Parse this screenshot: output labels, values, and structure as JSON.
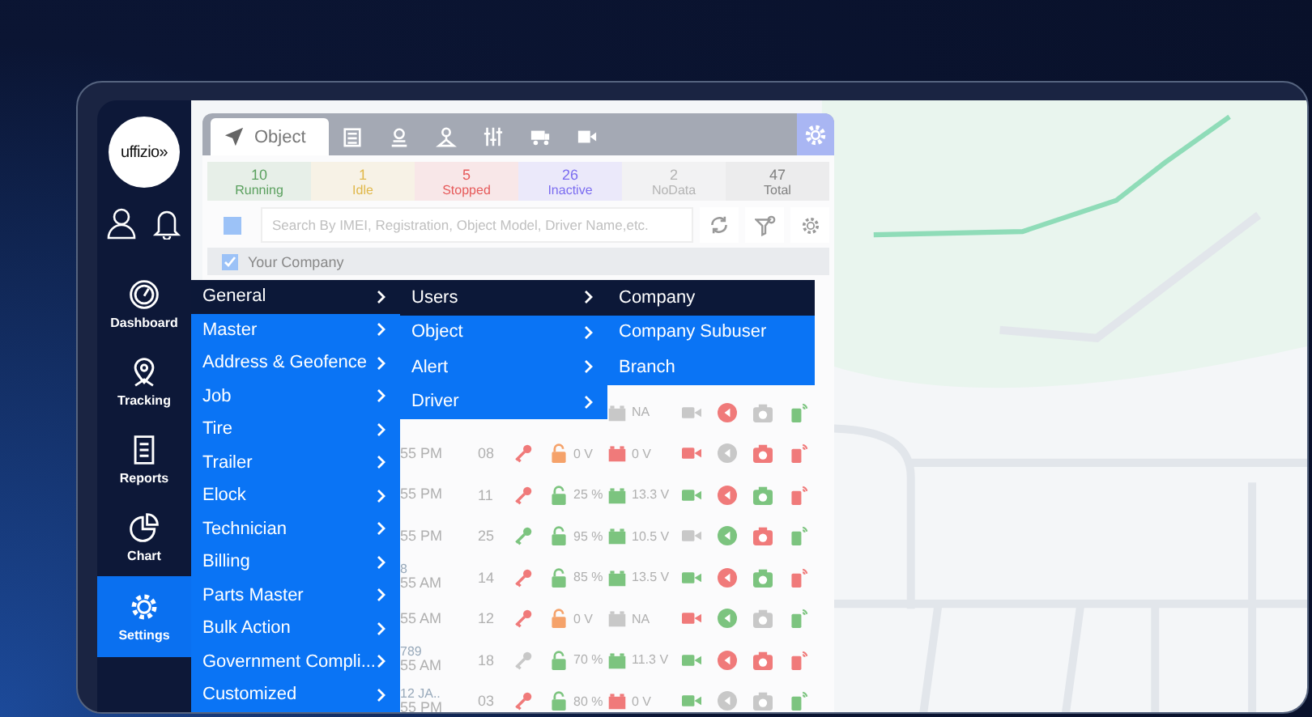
{
  "sidebar": {
    "logo": "uffizio»",
    "items": [
      {
        "label": "Dashboard",
        "selected": false
      },
      {
        "label": "Tracking",
        "selected": false
      },
      {
        "label": "Reports",
        "selected": false
      },
      {
        "label": "Chart",
        "selected": false
      },
      {
        "label": "Settings",
        "selected": true
      }
    ]
  },
  "panel": {
    "tabs": [
      {
        "label": "Object",
        "selected": true
      },
      {
        "selected": false
      },
      {
        "selected": false
      },
      {
        "selected": false
      },
      {
        "selected": false
      },
      {
        "selected": false
      },
      {
        "selected": false
      }
    ],
    "status": [
      {
        "count": "10",
        "label": "Running",
        "color": "#5aa05e"
      },
      {
        "count": "1",
        "label": "Idle",
        "color": "#e0b84a"
      },
      {
        "count": "5",
        "label": "Stopped",
        "color": "#e65a5a"
      },
      {
        "count": "26",
        "label": "Inactive",
        "color": "#7b6cf0"
      },
      {
        "count": "2",
        "label": "NoData",
        "color": "#b4b4b4"
      },
      {
        "count": "47",
        "label": "Total",
        "color": "#808080"
      }
    ],
    "search": {
      "placeholder": "Search By IMEI, Registration, Object Model, Driver Name,etc."
    },
    "company": {
      "label": "Your Company",
      "checked": true
    },
    "rows": [
      {
        "battery": {
          "color": "#c8c8c8",
          "reading": "NA"
        },
        "video": {
          "color": "#c8c8c8"
        },
        "rewind": {
          "color": "#f07a7a"
        },
        "camera": {
          "color": "#c8c8c8"
        },
        "phone": {
          "color": "#7cc47f"
        }
      },
      {
        "time": "55 PM",
        "number": "08",
        "key": {
          "color": "#f07a7a"
        },
        "lock": {
          "color": "#f5a26a",
          "reading": "0 V"
        },
        "battery": {
          "color": "#f07a7a",
          "reading": "0 V"
        },
        "video": {
          "color": "#f07a7a"
        },
        "rewind": {
          "color": "#c8c8c8"
        },
        "camera": {
          "color": "#f07a7a"
        },
        "phone": {
          "color": "#f07a7a"
        }
      },
      {
        "time": "55 PM",
        "number": "11",
        "key": {
          "color": "#f07a7a"
        },
        "lock": {
          "color": "#7cc47f",
          "reading": "25 %"
        },
        "battery": {
          "color": "#7cc47f",
          "reading": "13.3 V"
        },
        "video": {
          "color": "#7cc47f"
        },
        "rewind": {
          "color": "#f07a7a"
        },
        "camera": {
          "color": "#7cc47f"
        },
        "phone": {
          "color": "#f07a7a"
        }
      },
      {
        "time": "55 PM",
        "number": "25",
        "key": {
          "color": "#7cc47f"
        },
        "lock": {
          "color": "#7cc47f",
          "reading": "95 %"
        },
        "battery": {
          "color": "#7cc47f",
          "reading": "10.5 V"
        },
        "video": {
          "color": "#c8c8c8"
        },
        "rewind": {
          "color": "#7cc47f"
        },
        "camera": {
          "color": "#f07a7a"
        },
        "phone": {
          "color": "#7cc47f"
        }
      },
      {
        "ref": "8",
        "time": "55 AM",
        "number": "14",
        "key": {
          "color": "#f07a7a"
        },
        "lock": {
          "color": "#7cc47f",
          "reading": "85 %"
        },
        "battery": {
          "color": "#7cc47f",
          "reading": "13.5 V"
        },
        "video": {
          "color": "#7cc47f"
        },
        "rewind": {
          "color": "#f07a7a"
        },
        "camera": {
          "color": "#7cc47f"
        },
        "phone": {
          "color": "#f07a7a"
        }
      },
      {
        "time": "55 AM",
        "number": "12",
        "key": {
          "color": "#f07a7a"
        },
        "lock": {
          "color": "#f5a26a",
          "reading": "0 V"
        },
        "battery": {
          "color": "#c8c8c8",
          "reading": "NA"
        },
        "video": {
          "color": "#f07a7a"
        },
        "rewind": {
          "color": "#7cc47f"
        },
        "camera": {
          "color": "#c8c8c8"
        },
        "phone": {
          "color": "#7cc47f"
        }
      },
      {
        "ref": "789",
        "time": "55 AM",
        "number": "18",
        "key": {
          "color": "#c8c8c8"
        },
        "lock": {
          "color": "#7cc47f",
          "reading": "70 %"
        },
        "battery": {
          "color": "#7cc47f",
          "reading": "11.3 V"
        },
        "video": {
          "color": "#7cc47f"
        },
        "rewind": {
          "color": "#f07a7a"
        },
        "camera": {
          "color": "#f07a7a"
        },
        "phone": {
          "color": "#f07a7a"
        }
      },
      {
        "ref": "12 JA..",
        "time": "55 PM",
        "number": "03",
        "key": {
          "color": "#f07a7a"
        },
        "lock": {
          "color": "#7cc47f",
          "reading": "80 %"
        },
        "battery": {
          "color": "#f07a7a",
          "reading": "0 V"
        },
        "video": {
          "color": "#7cc47f"
        },
        "rewind": {
          "color": "#c8c8c8"
        },
        "camera": {
          "color": "#c8c8c8"
        },
        "phone": {
          "color": "#7cc47f"
        }
      }
    ]
  },
  "menu": {
    "columns": [
      [
        {
          "label": "General",
          "selected": true,
          "submenu": true
        },
        {
          "label": "Master",
          "selected": false,
          "submenu": true
        },
        {
          "label": "Address & Geofence",
          "selected": false,
          "submenu": true
        },
        {
          "label": "Job",
          "selected": false,
          "submenu": true
        },
        {
          "label": "Tire",
          "selected": false,
          "submenu": true
        },
        {
          "label": "Trailer",
          "selected": false,
          "submenu": true
        },
        {
          "label": "Elock",
          "selected": false,
          "submenu": true
        },
        {
          "label": "Technician",
          "selected": false,
          "submenu": true
        },
        {
          "label": "Billing",
          "selected": false,
          "submenu": true
        },
        {
          "label": "Parts Master",
          "selected": false,
          "submenu": true
        },
        {
          "label": "Bulk Action",
          "selected": false,
          "submenu": true
        },
        {
          "label": "Government Compli...",
          "selected": false,
          "submenu": true
        },
        {
          "label": "Customized",
          "selected": false,
          "submenu": true
        }
      ],
      [
        {
          "label": "Users",
          "selected": true,
          "submenu": true
        },
        {
          "label": "Object",
          "selected": false,
          "submenu": true
        },
        {
          "label": "Alert",
          "selected": false,
          "submenu": true
        },
        {
          "label": "Driver",
          "selected": false,
          "submenu": true
        }
      ],
      [
        {
          "label": "Company",
          "selected": true,
          "submenu": false
        },
        {
          "label": "Company Subuser",
          "selected": false,
          "submenu": false
        },
        {
          "label": "Branch",
          "selected": false,
          "submenu": false
        }
      ]
    ]
  }
}
